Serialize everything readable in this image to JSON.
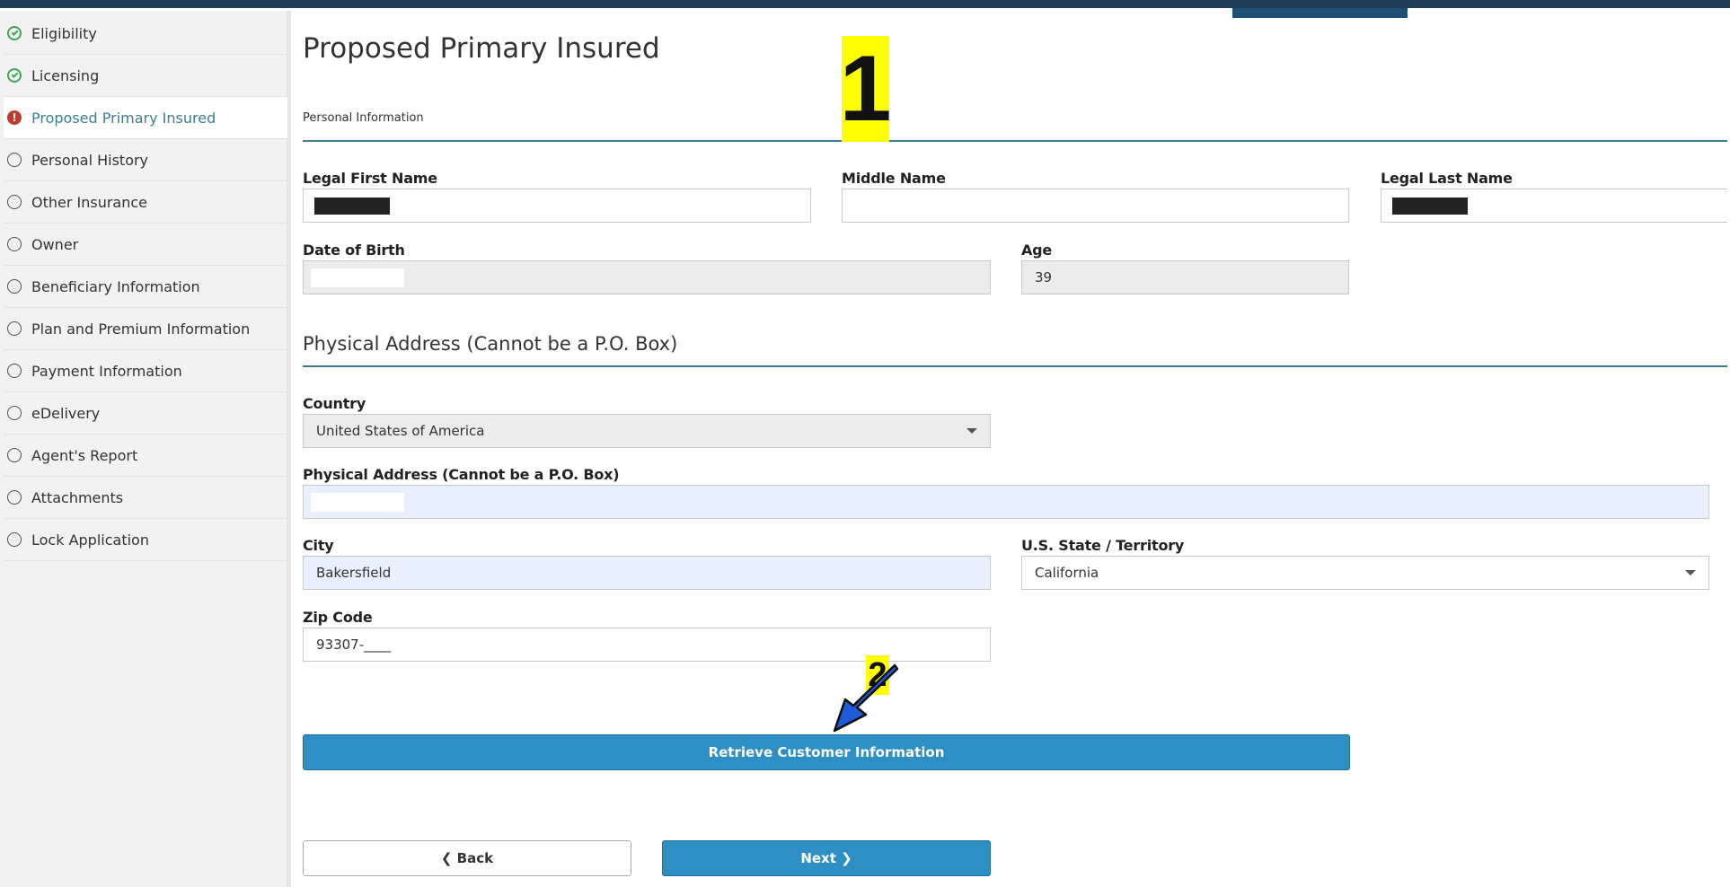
{
  "sidebar": {
    "items": [
      {
        "label": "Eligibility",
        "status": "complete"
      },
      {
        "label": "Licensing",
        "status": "complete"
      },
      {
        "label": "Proposed Primary Insured",
        "status": "error"
      },
      {
        "label": "Personal History",
        "status": "pending"
      },
      {
        "label": "Other Insurance",
        "status": "pending"
      },
      {
        "label": "Owner",
        "status": "pending"
      },
      {
        "label": "Beneficiary Information",
        "status": "pending"
      },
      {
        "label": "Plan and Premium Information",
        "status": "pending"
      },
      {
        "label": "Payment Information",
        "status": "pending"
      },
      {
        "label": "eDelivery",
        "status": "pending"
      },
      {
        "label": "Agent's Report",
        "status": "pending"
      },
      {
        "label": "Attachments",
        "status": "pending"
      },
      {
        "label": "Lock Application",
        "status": "pending"
      }
    ],
    "error_glyph": "!"
  },
  "page": {
    "title": "Proposed Primary Insured",
    "section": "Personal Information"
  },
  "personal": {
    "first_name_label": "Legal First Name",
    "middle_name_label": "Middle Name",
    "middle_name_value": "",
    "last_name_label": "Legal Last Name",
    "dob_label": "Date of Birth",
    "age_label": "Age",
    "age_value": "39"
  },
  "address": {
    "heading": "Physical Address (Cannot be a P.O. Box)",
    "country_label": "Country",
    "country_value": "United States of America",
    "street_label": "Physical Address (Cannot be a P.O. Box)",
    "city_label": "City",
    "city_value": "Bakersfield",
    "state_label": "U.S. State / Territory",
    "state_value": "California",
    "zip_label": "Zip Code",
    "zip_value": "93307-____"
  },
  "actions": {
    "retrieve_label": "Retrieve Customer Information",
    "back_label": "❮ Back",
    "next_label": "Next ❯"
  },
  "annotations": {
    "step1": "1",
    "step2": "2"
  },
  "colors": {
    "primary_button": "#2d8fc4",
    "divider": "#3f7d93",
    "complete_icon": "#3aa84f",
    "error_icon": "#c0392b",
    "active_nav_text": "#3b7f8e",
    "annotation_highlight": "#ffff00",
    "annotation_arrow": "#1e5bd8"
  },
  "icons": {
    "complete": "check-circle-icon",
    "error": "exclamation-circle-icon",
    "pending": "empty-circle-icon",
    "dropdown": "caret-down-icon"
  }
}
